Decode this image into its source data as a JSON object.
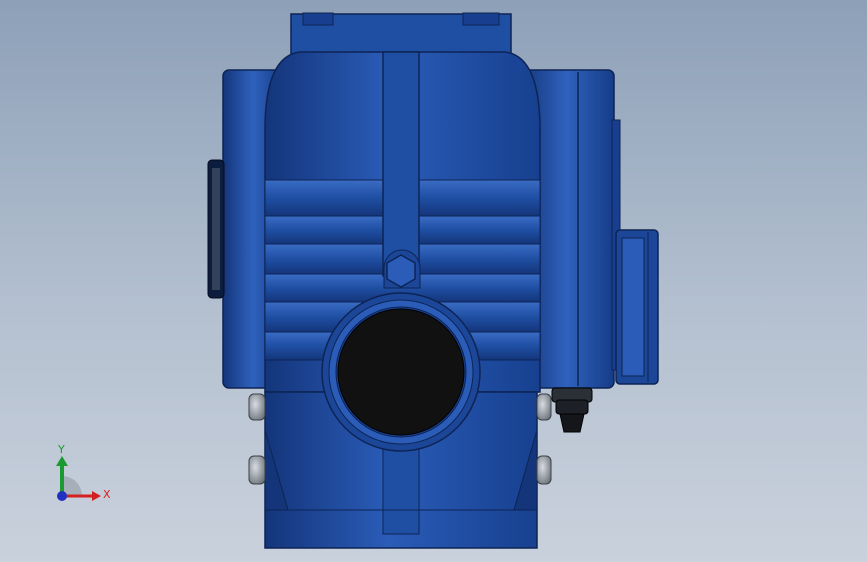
{
  "viewport": {
    "background_top": "#8da0b8",
    "background_bottom": "#c9d1dc"
  },
  "model": {
    "body_color": "#1f4fa3",
    "body_dark": "#14357a",
    "body_light": "#3a6cc4",
    "seal_color": "#111111",
    "bolt_color": "#9aa0a8"
  },
  "triad": {
    "x_label": "X",
    "y_label": "Y",
    "x_color": "#d42020",
    "y_color": "#1a9a30",
    "z_color": "#2030c0"
  }
}
